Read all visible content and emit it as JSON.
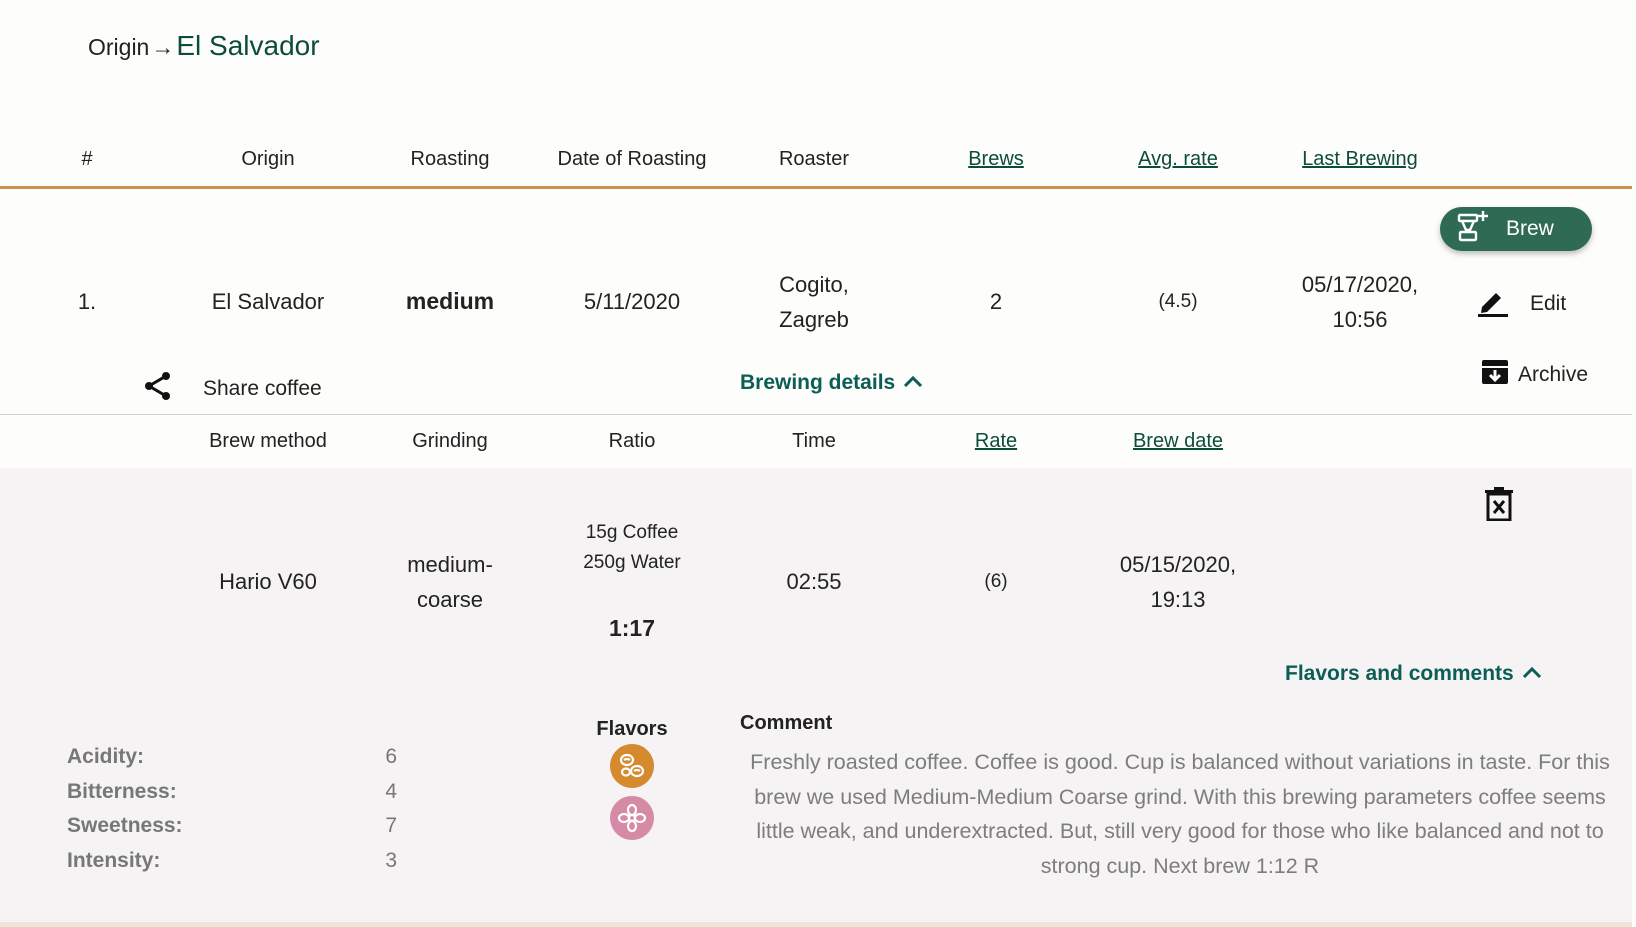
{
  "breadcrumb": {
    "parent": "Origin",
    "arrow": "→",
    "current": "El Salvador"
  },
  "table": {
    "headers": {
      "num": "#",
      "origin": "Origin",
      "roasting": "Roasting",
      "date_of_roasting": "Date of Roasting",
      "roaster": "Roaster",
      "brews": "Brews",
      "avg_rate": "Avg. rate",
      "last_brewing": "Last Brewing"
    },
    "row": {
      "num": "1.",
      "origin": "El Salvador",
      "roasting": "medium",
      "date": "5/11/2020",
      "roaster_line1": "Cogito,",
      "roaster_line2": "Zagreb",
      "brews": "2",
      "avg_rate": "(4.5)",
      "last_line1": "05/17/2020,",
      "last_line2": "10:56"
    }
  },
  "actions": {
    "brew": "Brew",
    "edit": "Edit",
    "archive": "Archive",
    "share": "Share coffee",
    "brewing_details": "Brewing details"
  },
  "brew_table": {
    "headers": {
      "method": "Brew method",
      "grinding": "Grinding",
      "ratio": "Ratio",
      "time": "Time",
      "rate": "Rate",
      "brew_date": "Brew date"
    },
    "row": {
      "method": "Hario V60",
      "grinding_line1": "medium-",
      "grinding_line2": "coarse",
      "coffee": "15g Coffee",
      "water": "250g Water",
      "ratio": "1:17",
      "time": "02:55",
      "rate": "(6)",
      "date_line1": "05/15/2020,",
      "date_line2": "19:13"
    }
  },
  "flavors_toggle": "Flavors and comments",
  "attributes": [
    {
      "label": "Acidity:",
      "value": "6"
    },
    {
      "label": "Bitterness:",
      "value": "4"
    },
    {
      "label": "Sweetness:",
      "value": "7"
    },
    {
      "label": "Intensity:",
      "value": "3"
    }
  ],
  "flavors": {
    "title": "Flavors",
    "icons": [
      {
        "name": "nutty-flavor-icon",
        "color": "#d68a2e"
      },
      {
        "name": "floral-flavor-icon",
        "color": "#d58aa6"
      }
    ]
  },
  "comment": {
    "title": "Comment",
    "text": "Freshly roasted coffee. Coffee is good. Cup is balanced without variations in taste. For this brew we used Medium-Medium Coarse grind. With this brewing parameters coffee seems little weak, and underextracted. But, still very good for those who like balanced and not to strong cup. Next brew 1:12 R"
  },
  "colors": {
    "accent_green": "#0b4d39",
    "button_green": "#2f6b54",
    "header_line": "#c8944e"
  }
}
